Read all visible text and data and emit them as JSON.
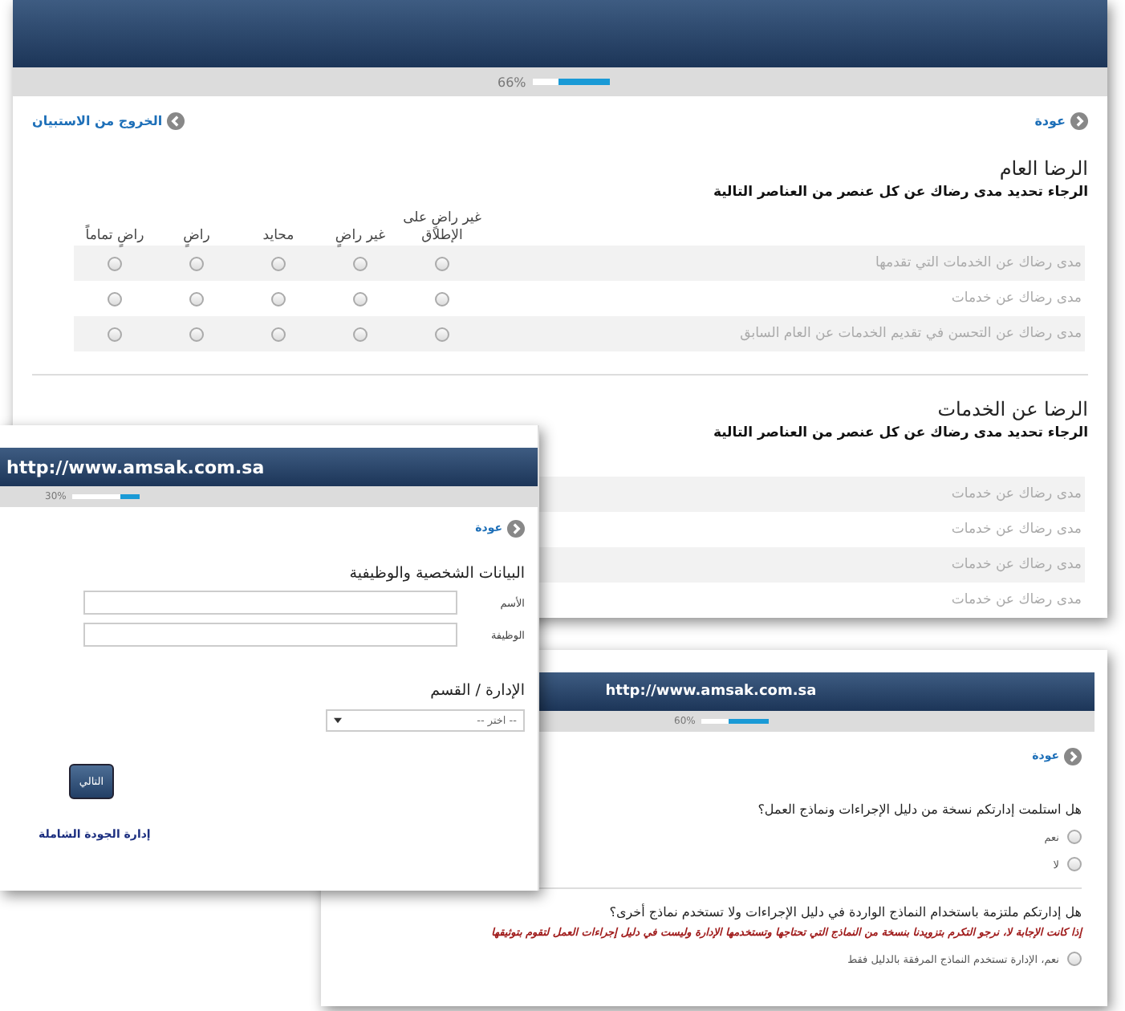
{
  "survey_window": {
    "progress": {
      "reading": "66%",
      "level": 0.66
    },
    "back_link": "عودة",
    "exit_link": "الخروج من الاستبيان",
    "sections": [
      {
        "title": "الرضا العام",
        "instruction": "الرجاء تحديد مدى رضاك عن كل عنصر من العناصر التالية",
        "columns": [
          "غير راضٍ على الإطلاق",
          "غير راضٍ",
          "محايد",
          "راضٍ",
          "راضٍ تماماً"
        ],
        "rows": [
          {
            "label": "مدى رضاك عن الخدمات التي تقدمها",
            "radios": [
              {
                "selected": false
              },
              {
                "selected": false
              },
              {
                "selected": false
              },
              {
                "selected": false
              },
              {
                "selected": false
              }
            ]
          },
          {
            "label": "مدى رضاك عن خدمات",
            "radios": [
              {
                "selected": false
              },
              {
                "selected": false
              },
              {
                "selected": false
              },
              {
                "selected": false
              },
              {
                "selected": false
              }
            ]
          },
          {
            "label": "مدى رضاك عن التحسن في تقديم الخدمات عن العام السابق",
            "radios": [
              {
                "selected": false
              },
              {
                "selected": false
              },
              {
                "selected": false
              },
              {
                "selected": false
              },
              {
                "selected": false
              }
            ]
          }
        ]
      },
      {
        "title": "الرضا عن الخدمات",
        "instruction": "الرجاء تحديد مدى رضاك عن كل عنصر من العناصر التالية",
        "rows": [
          {
            "label": "مدى رضاك عن خدمات"
          },
          {
            "label": "مدى رضاك عن خدمات"
          },
          {
            "label": "مدى رضاك عن خدمات"
          },
          {
            "label": "مدى رضاك عن خدمات"
          }
        ]
      }
    ]
  },
  "profile_window": {
    "url": "http://www.amsak.com.sa",
    "progress": {
      "reading": "30%",
      "level": 0.3
    },
    "back_link": "عودة",
    "title": "البيانات الشخصية والوظيفية",
    "fields": [
      {
        "label": "الأسم"
      },
      {
        "label": "الوظيفة"
      }
    ],
    "department": {
      "title": "الإدارة / القسم",
      "value": "-- اختر --"
    },
    "next_button": "التالي",
    "footer_link": "إدارة الجودة الشاملة"
  },
  "questions_window": {
    "url": "http://www.amsak.com.sa",
    "progress": {
      "reading": "60%",
      "level": 0.6
    },
    "back_link": "عودة",
    "questions": [
      {
        "text": "هل استلمت إدارتكم نسخة من دليل الإجراءات ونماذج العمل؟",
        "options": [
          {
            "label": "نعم",
            "selected": false
          },
          {
            "label": "لا",
            "selected": false
          }
        ]
      },
      {
        "text": "هل إدارتكم ملتزمة باستخدام النماذج الواردة في دليل الإجراءات ولا تستخدم نماذج أخرى؟",
        "note": "إذا كانت الإجابة لا، نرجو التكرم بتزويدنا بنسخة من النماذج التي تحتاجها وتستخدمها الإدارة وليست في دليل إجراءات العمل لتقوم بتوثيقها",
        "options": [
          {
            "label": "نعم، الإدارة تستخدم النماذج المرفقة بالدليل فقط",
            "selected": false
          }
        ]
      }
    ]
  }
}
